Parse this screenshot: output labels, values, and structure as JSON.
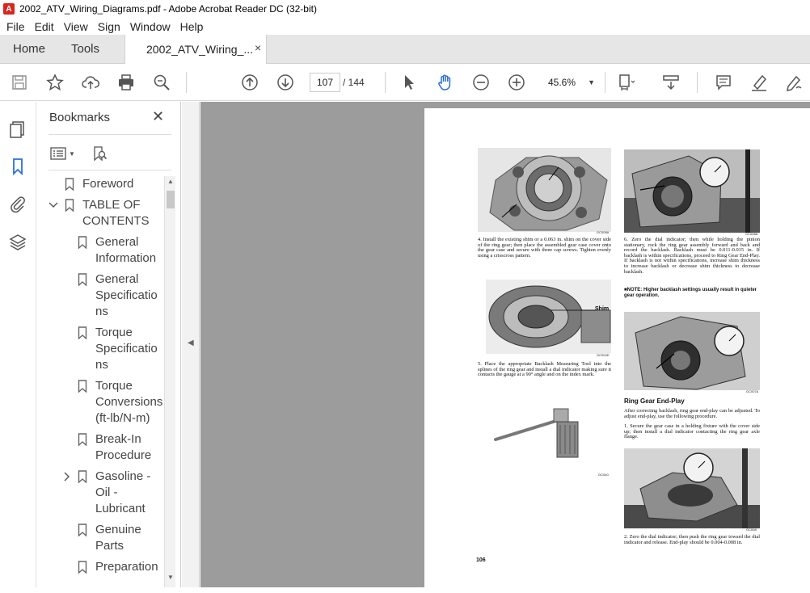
{
  "window": {
    "title": "2002_ATV_Wiring_Diagrams.pdf - Adobe Acrobat Reader DC (32-bit)"
  },
  "menu": [
    "File",
    "Edit",
    "View",
    "Sign",
    "Window",
    "Help"
  ],
  "tabs": {
    "home": "Home",
    "tools": "Tools",
    "document": "2002_ATV_Wiring_...",
    "close": "×"
  },
  "toolbar": {
    "page_current": "107",
    "page_total": "/ 144",
    "zoom": "45.6%"
  },
  "bookmarks": {
    "title": "Bookmarks",
    "close": "✕",
    "items": [
      {
        "label": "Foreword",
        "level": 0,
        "expander": ""
      },
      {
        "label": "TABLE OF\nCONTENTS",
        "level": 0,
        "expander": "expanded"
      },
      {
        "label": "General\nInformation",
        "level": 1,
        "expander": ""
      },
      {
        "label": "General\nSpecificatio\nns",
        "level": 1,
        "expander": ""
      },
      {
        "label": "Torque\nSpecificatio\nns",
        "level": 1,
        "expander": ""
      },
      {
        "label": "Torque\nConversions\n(ft-lb/N-m)",
        "level": 1,
        "expander": ""
      },
      {
        "label": "Break-In\nProcedure",
        "level": 1,
        "expander": ""
      },
      {
        "label": "Gasoline -\nOil -\nLubricant",
        "level": 1,
        "expander": "collapsed"
      },
      {
        "label": "Genuine\nParts",
        "level": 1,
        "expander": ""
      },
      {
        "label": "Preparation",
        "level": 1,
        "expander": ""
      }
    ]
  },
  "page": {
    "captions": {
      "c1": "GC008A",
      "c2": "GC008A",
      "c3": "GC004D",
      "c4": "GC007A",
      "c5": "GC040",
      "c6": "GC008"
    },
    "shim_label": "Shim",
    "step4": "4. Install the existing shim or a 0.063 in. shim on the cover side of the ring gear; then place the assembled gear case cover onto the gear case and secure with three cap screws. Tighten evenly using a crisscross pattern.",
    "step5": "5. Place the appropriate Backlash Measuring Tool into the splines of the ring gear and install a dial indicator making sure it contacts the gauge at a 90° angle and on the index mark.",
    "step6": "6. Zero the dial indicator; then while holding the pinion stationary, rock the ring gear assembly forward and back and record the backlash. Backlash must be 0.011-0.015 in. If backlash is within specifications, proceed to Ring Gear End-Play. If backlash is not within specifications, increase shim thickness to increase backlash or decrease shim thickness to decrease backlash.",
    "note": "■NOTE: Higher backlash settings usually result in quieter gear operation.",
    "heading": "Ring Gear End-Play",
    "intro": "After correcting backlash, ring gear end-play can be adjusted. To adjust end-play, use the following procedure.",
    "sub1": "1. Secure the gear case in a holding fixture with the cover side up; then install a dial indicator contacting the ring gear axle flange.",
    "sub2": "2. Zero the dial indicator; then push the ring gear toward the dial indicator and release. End-play should be 0.004-0.008 in.",
    "page_number": "106"
  }
}
